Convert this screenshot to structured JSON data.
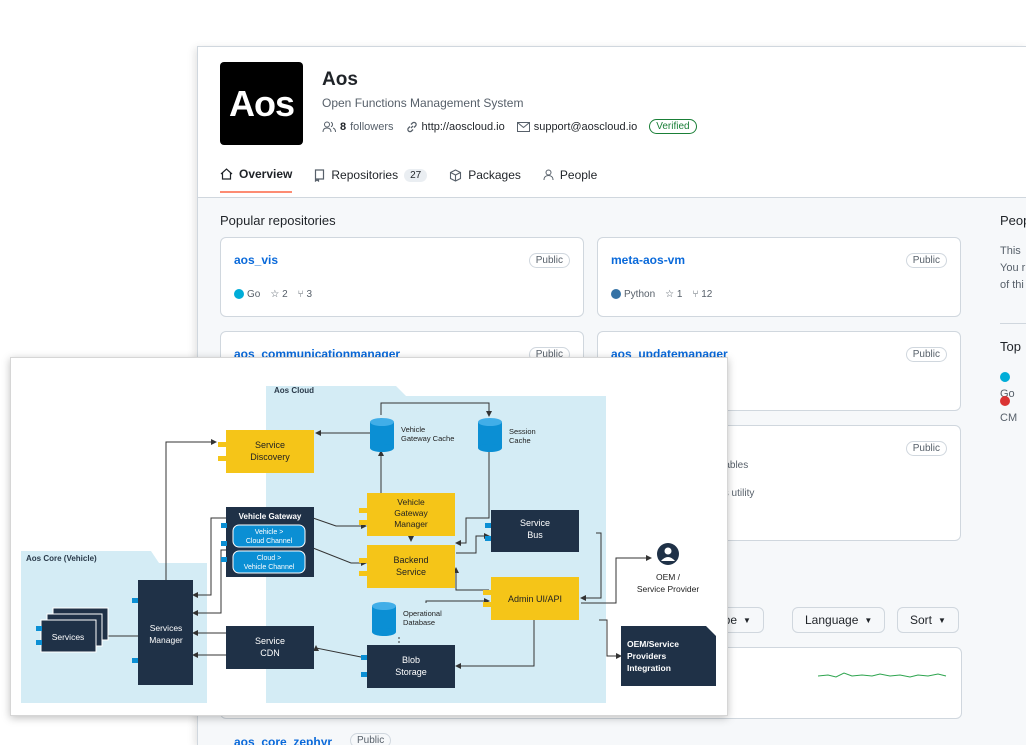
{
  "org": {
    "logo_text": "Aos",
    "name": "Aos",
    "description": "Open Functions Management System",
    "followers_count": "8",
    "followers_label": "followers",
    "url": "http://aoscloud.io",
    "email": "support@aoscloud.io",
    "verified": "Verified"
  },
  "tabs": [
    {
      "label": "Overview",
      "icon": "home-icon"
    },
    {
      "label": "Repositories",
      "icon": "repo-icon",
      "count": "27"
    },
    {
      "label": "Packages",
      "icon": "package-icon"
    },
    {
      "label": "People",
      "icon": "person-icon"
    }
  ],
  "popular_title": "Popular repositories",
  "repos": [
    {
      "name": "aos_vis",
      "visibility": "Public",
      "language": "Go",
      "lang_color": "#00ADD8",
      "stars": "2",
      "forks": "3"
    },
    {
      "name": "meta-aos-vm",
      "visibility": "Public",
      "language": "Python",
      "lang_color": "#3572A5",
      "stars": "1",
      "forks": "12"
    },
    {
      "name": "aos_communicationmanager",
      "visibility": "Public"
    },
    {
      "name": "aos_updatemanager",
      "visibility": "Public"
    },
    {
      "visibility": "Public",
      "desc1": "ptables",
      "desc2": "les utility"
    }
  ],
  "sidebar": {
    "people_title": "Peop",
    "people_text": [
      "This",
      "You r",
      "of thi"
    ],
    "top_title": "Top",
    "top_langs": [
      {
        "label": "Go",
        "color": "#00ADD8"
      },
      {
        "label": "CM",
        "color": "#DA3434"
      }
    ]
  },
  "filters": {
    "type": "Type",
    "language": "Language",
    "sort": "Sort"
  },
  "bottom_repo": {
    "name": "aos_core_zephyr",
    "visibility": "Public"
  },
  "diagram": {
    "aos_cloud": "Aos Cloud",
    "aos_core": "Aos Core (Vehicle)",
    "service_discovery": [
      "Service",
      "Discovery"
    ],
    "vehicle_gateway_cache": [
      "Vehicle",
      "Gateway Cache"
    ],
    "session_cache": [
      "Session",
      "Cache"
    ],
    "vehicle_gateway": "Vehicle Gateway",
    "v2c": [
      "Vehicle >",
      "Cloud Channel"
    ],
    "c2v": [
      "Cloud >",
      "Vehicle Channel"
    ],
    "vg_manager": [
      "Vehicle",
      "Gateway",
      "Manager"
    ],
    "service_bus": [
      "Service",
      "Bus"
    ],
    "backend": [
      "Backend",
      "Service"
    ],
    "oem": [
      "OEM /",
      "Service Provider"
    ],
    "admin": "Admin UI/API",
    "op_db": [
      "Operational",
      "Database"
    ],
    "services": "Services",
    "services_manager": [
      "Services",
      "Manager"
    ],
    "service_cdn": [
      "Service",
      "CDN"
    ],
    "blob": [
      "Blob",
      "Storage"
    ],
    "oem_integration": [
      "OEM/Service",
      "Providers",
      "Integration"
    ]
  }
}
